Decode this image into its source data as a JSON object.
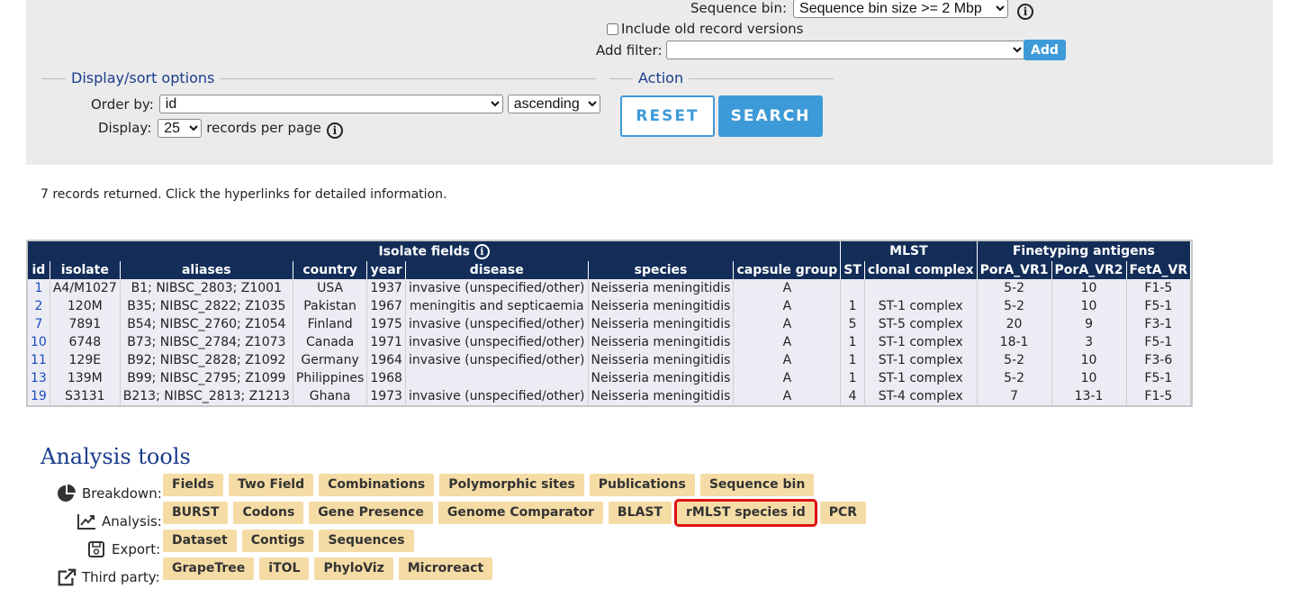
{
  "filters": {
    "sequence_bin_label": "Sequence bin:",
    "sequence_bin_value": "Sequence bin size >= 2 Mbp",
    "include_old_label": "Include old record versions",
    "add_filter_label": "Add filter:",
    "add_filter_value": "",
    "add_button": "Add"
  },
  "display": {
    "legend": "Display/sort options",
    "order_by_label": "Order by:",
    "order_by_value": "id",
    "direction_value": "ascending",
    "display_label": "Display:",
    "display_value": "25",
    "records_per_page": "records per page"
  },
  "action": {
    "legend": "Action",
    "reset": "RESET",
    "search": "SEARCH"
  },
  "summary": "7 records returned. Click the hyperlinks for detailed information.",
  "table": {
    "groups": [
      "Isolate fields",
      "MLST",
      "Finetyping antigens"
    ],
    "columns": [
      "id",
      "isolate",
      "aliases",
      "country",
      "year",
      "disease",
      "species",
      "capsule group",
      "ST",
      "clonal complex",
      "PorA_VR1",
      "PorA_VR2",
      "FetA_VR"
    ],
    "rows": [
      [
        "1",
        "A4/M1027",
        "B1; NIBSC_2803; Z1001",
        "USA",
        "1937",
        "invasive (unspecified/other)",
        "Neisseria meningitidis",
        "A",
        "",
        "",
        "5-2",
        "10",
        "F1-5"
      ],
      [
        "2",
        "120M",
        "B35; NIBSC_2822; Z1035",
        "Pakistan",
        "1967",
        "meningitis and septicaemia",
        "Neisseria meningitidis",
        "A",
        "1",
        "ST-1 complex",
        "5-2",
        "10",
        "F5-1"
      ],
      [
        "7",
        "7891",
        "B54; NIBSC_2760; Z1054",
        "Finland",
        "1975",
        "invasive (unspecified/other)",
        "Neisseria meningitidis",
        "A",
        "5",
        "ST-5 complex",
        "20",
        "9",
        "F3-1"
      ],
      [
        "10",
        "6748",
        "B73; NIBSC_2784; Z1073",
        "Canada",
        "1971",
        "invasive (unspecified/other)",
        "Neisseria meningitidis",
        "A",
        "1",
        "ST-1 complex",
        "18-1",
        "3",
        "F5-1"
      ],
      [
        "11",
        "129E",
        "B92; NIBSC_2828; Z1092",
        "Germany",
        "1964",
        "invasive (unspecified/other)",
        "Neisseria meningitidis",
        "A",
        "1",
        "ST-1 complex",
        "5-2",
        "10",
        "F3-6"
      ],
      [
        "13",
        "139M",
        "B99; NIBSC_2795; Z1099",
        "Philippines",
        "1968",
        "",
        "Neisseria meningitidis",
        "A",
        "1",
        "ST-1 complex",
        "5-2",
        "10",
        "F5-1"
      ],
      [
        "19",
        "S3131",
        "B213; NIBSC_2813; Z1213",
        "Ghana",
        "1973",
        "invasive (unspecified/other)",
        "Neisseria meningitidis",
        "A",
        "4",
        "ST-4 complex",
        "7",
        "13-1",
        "F1-5"
      ]
    ]
  },
  "analysis": {
    "title": "Analysis tools",
    "rows": [
      {
        "label": "Breakdown:",
        "icon": "pie-chart-icon",
        "buttons": [
          "Fields",
          "Two Field",
          "Combinations",
          "Polymorphic sites",
          "Publications",
          "Sequence bin"
        ]
      },
      {
        "label": "Analysis:",
        "icon": "line-chart-icon",
        "buttons": [
          "BURST",
          "Codons",
          "Gene Presence",
          "Genome Comparator",
          "BLAST",
          "rMLST species id",
          "PCR"
        ]
      },
      {
        "label": "Export:",
        "icon": "save-icon",
        "buttons": [
          "Dataset",
          "Contigs",
          "Sequences"
        ]
      },
      {
        "label": "Third party:",
        "icon": "external-link-icon",
        "buttons": [
          "GrapeTree",
          "iTOL",
          "PhyloViz",
          "Microreact"
        ]
      }
    ],
    "highlighted": "rMLST species id"
  }
}
